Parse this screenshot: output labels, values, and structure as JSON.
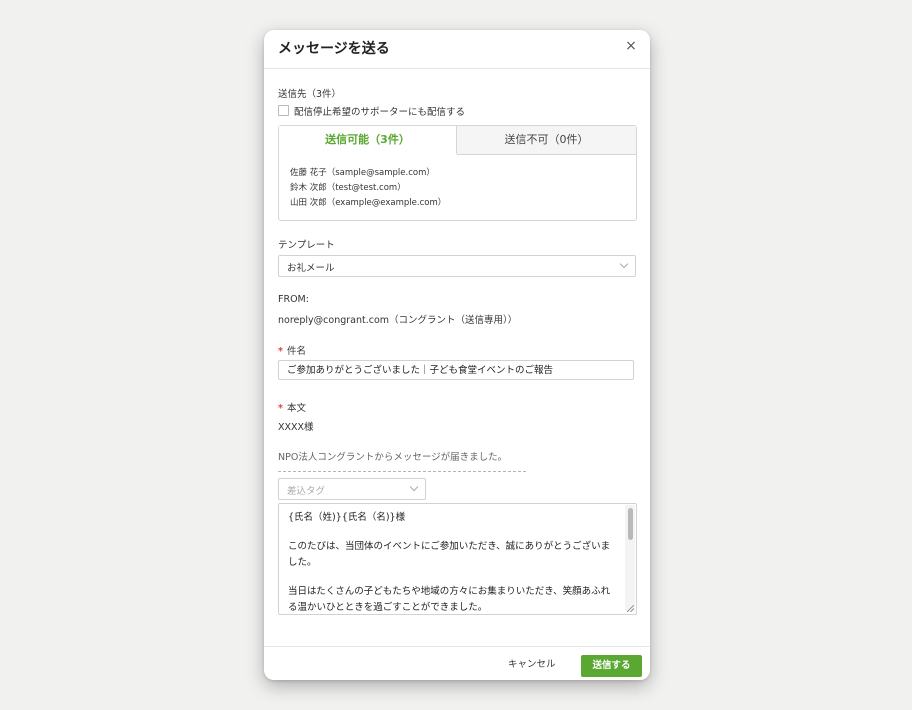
{
  "modal": {
    "title": "メッセージを送る",
    "close_glyph": "×"
  },
  "recipients_section": {
    "label": "送信先（3件）",
    "checkbox_label": "配信停止希望のサポーターにも配信する",
    "checkbox_checked": false,
    "tabs": [
      {
        "label": "送信可能（3件）",
        "active": true
      },
      {
        "label": "送信不可（0件）",
        "active": false
      }
    ],
    "recipients": [
      "佐藤 花子（sample@sample.com）",
      "鈴木 次郎（test@test.com）",
      "山田 次郎（example@example.com）"
    ]
  },
  "template": {
    "label": "テンプレート",
    "selected": "お礼メール"
  },
  "from": {
    "label": "FROM:",
    "value": "noreply@congrant.com（コングラント（送信専用））"
  },
  "subject": {
    "required_mark": "*",
    "label": "件名",
    "value": "ご参加ありがとうございました｜子ども食堂イベントのご報告"
  },
  "body": {
    "required_mark": "*",
    "label": "本文",
    "header_line": "XXXX様",
    "intro_line": "NPO法人コングラントからメッセージが届きました。",
    "tag_placeholder": "差込タグ",
    "textarea_lines": [
      "{氏名（姓)}{氏名（名)}様",
      "",
      "このたびは、当団体のイベントにご参加いただき、誠にありがとうございま",
      "した。",
      "",
      "当日はたくさんの子どもたちや地域の方々にお集まりいただき、笑顔あふれ",
      "る温かいひとときを過ごすことができました。"
    ]
  },
  "footer": {
    "cancel_label": "キャンセル",
    "send_label": "送信する"
  },
  "colors": {
    "accent_green": "#5aa832",
    "required_red": "#d64a3f",
    "background": "#f1f1f0"
  }
}
